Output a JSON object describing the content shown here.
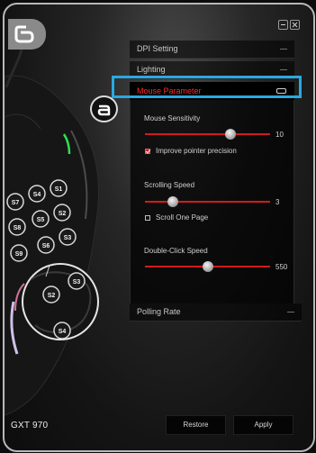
{
  "window": {
    "title_badge_icon": "number-six-badge-icon",
    "minimize_icon": "minimize-icon",
    "close_icon": "close-icon"
  },
  "panel": {
    "sections": {
      "dpi_setting": "DPI Setting",
      "lighting": "Lighting",
      "mouse_parameter": "Mouse Parameter",
      "polling_rate": "Polling Rate"
    },
    "mouse_sensitivity": {
      "label": "Mouse Sensitivity",
      "value": "10",
      "level": 0.68
    },
    "improve_pointer_precision": {
      "label": "Improve pointer precision",
      "checked": true
    },
    "scrolling_speed": {
      "label": "Scrolling Speed",
      "value": "3",
      "level": 0.22
    },
    "scroll_one_page": {
      "label": "Scroll One Page",
      "checked": false
    },
    "double_click_speed": {
      "label": "Double-Click Speed",
      "value": "550",
      "level": 0.5
    }
  },
  "mouse_buttons": [
    "S1",
    "S2",
    "S3",
    "S4",
    "S5",
    "S6",
    "S7",
    "S8",
    "S9"
  ],
  "mouse_zoom_buttons": [
    "S2",
    "S3",
    "S4"
  ],
  "callout": {
    "badge_icon": "letter-a-callout-icon"
  },
  "footer": {
    "product": "GXT 970",
    "restore_label": "Restore",
    "apply_label": "Apply"
  },
  "colors": {
    "accent_red": "#d21b1b",
    "highlight_blue": "#2aa8df",
    "header_active_text": "#ff2a2a"
  }
}
